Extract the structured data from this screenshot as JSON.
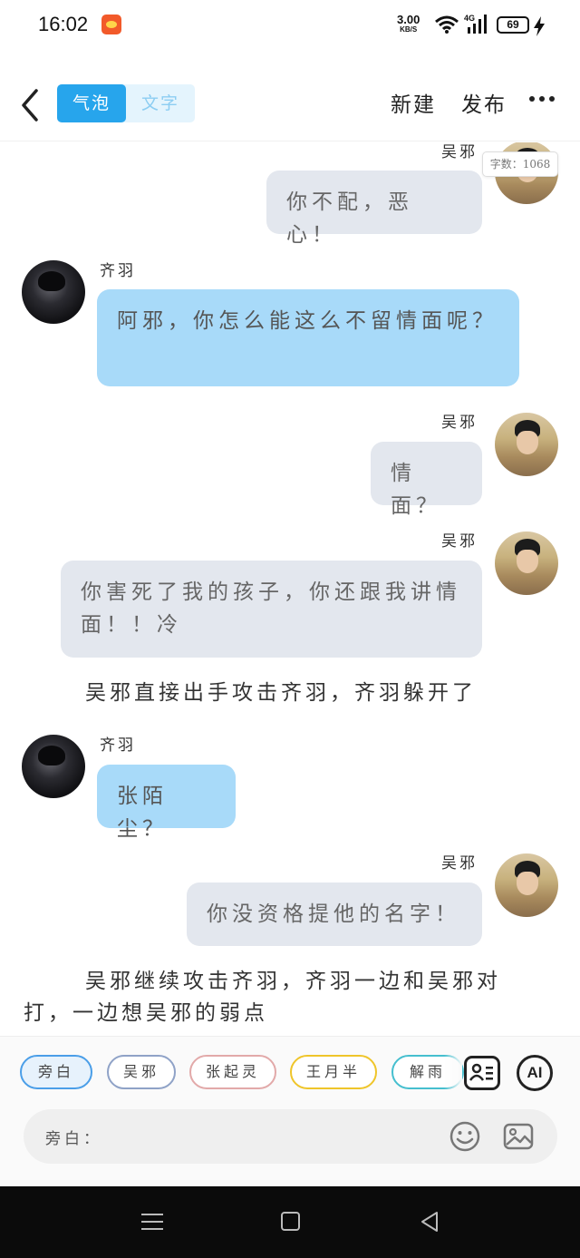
{
  "status_bar": {
    "time": "16:02",
    "net_speed_value": "3.00",
    "net_speed_unit": "KB/S",
    "network_type": "4G",
    "battery_level": "69"
  },
  "header": {
    "toggle_bubble": "气泡",
    "toggle_text": "文字",
    "new_label": "新建",
    "publish_label": "发布"
  },
  "chat": {
    "word_count": "字数：1068",
    "messages": [
      {
        "side": "right",
        "speaker": "吴邪",
        "text": "你不配，恶心！"
      },
      {
        "side": "left",
        "speaker": "齐羽",
        "text": "阿邪，你怎么能这么不留情面呢？"
      },
      {
        "side": "right",
        "speaker": "吴邪",
        "text": "情面？"
      },
      {
        "side": "right",
        "speaker": "吴邪",
        "text": "你害死了我的孩子，你还跟我讲情面！！冷"
      },
      {
        "side": "narration",
        "text": "吴邪直接出手攻击齐羽，齐羽躲开了"
      },
      {
        "side": "left",
        "speaker": "齐羽",
        "text": "张陌尘？"
      },
      {
        "side": "right",
        "speaker": "吴邪",
        "text": "你没资格提他的名字！"
      },
      {
        "side": "narration",
        "text": "吴邪继续攻击齐羽，齐羽一边和吴邪对打，一边想吴邪的弱点"
      }
    ]
  },
  "roles": {
    "chips": [
      "旁白",
      "吴邪",
      "张起灵",
      "王月半",
      "解雨"
    ],
    "ai_label": "AI"
  },
  "input": {
    "label": "旁白："
  },
  "colors": {
    "accent": "#27a5ec",
    "left_bubble": "#a8daf9",
    "right_bubble": "#e3e7ee"
  }
}
